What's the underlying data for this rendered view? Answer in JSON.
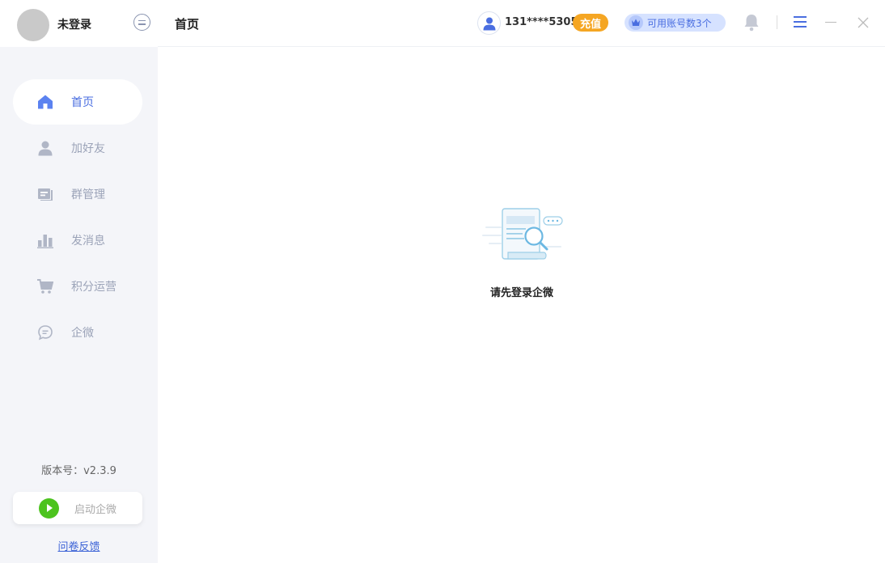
{
  "user": {
    "name": "未登录"
  },
  "header": {
    "title": "首页",
    "phone": "131****5305",
    "recharge_label": "充值",
    "accounts_label": "可用账号数3个"
  },
  "sidebar": {
    "items": [
      {
        "label": "首页",
        "icon": "home-icon",
        "active": true
      },
      {
        "label": "加好友",
        "icon": "person-icon",
        "active": false
      },
      {
        "label": "群管理",
        "icon": "group-icon",
        "active": false
      },
      {
        "label": "发消息",
        "icon": "chart-icon",
        "active": false
      },
      {
        "label": "积分运营",
        "icon": "cart-icon",
        "active": false
      },
      {
        "label": "企微",
        "icon": "chat-icon",
        "active": false
      }
    ],
    "version": "版本号：v2.3.9",
    "launch_label": "启动企微",
    "feedback_label": "问卷反馈"
  },
  "main": {
    "empty_message": "请先登录企微"
  },
  "colors": {
    "accent": "#4a6ee0",
    "recharge": "#f5a623",
    "launch": "#4cc31e",
    "sidebar_bg": "#f4f5f9"
  }
}
